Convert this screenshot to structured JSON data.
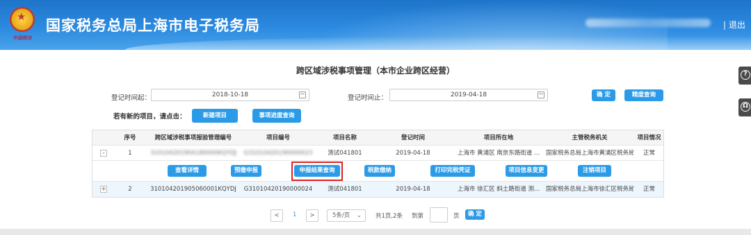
{
  "header": {
    "site_title": "国家税务总局上海市电子税务局",
    "logout": "| 退出",
    "emblem_sig": "中国税务"
  },
  "page": {
    "title": "跨区域涉税事项管理（本市企业跨区经营）"
  },
  "filters": {
    "start_label": "登记时间起：",
    "start_value": "2018-10-18",
    "end_label": "登记时间止：",
    "end_value": "2019-04-18",
    "confirm": "确 定",
    "progress_query": "精度查询",
    "new_item_prompt": "若有新的项目，请点击：",
    "new_item": "新建项目",
    "item_progress": "事项进度查询"
  },
  "table": {
    "headers": [
      "序号",
      "跨区域涉税事项报验管理编号",
      "项目编号",
      "项目名称",
      "登记时间",
      "项目所在地",
      "主管税务机关",
      "项目情况"
    ],
    "rows": [
      {
        "toggle": "-",
        "no": "1",
        "report_no": "310104201904180000KQYDJ",
        "item_no": "G31010420190000023",
        "item_name": "测试041801",
        "reg_time": "2019-04-18",
        "location": "上海市 黄浦区 南京东路街道 ...",
        "tax_office": "国家税务总局上海市黄浦区税务局",
        "status": "正常"
      },
      {
        "toggle": "+",
        "no": "2",
        "report_no": "310104201905060001KQYDJ",
        "item_no": "G31010420190000024",
        "item_name": "测试041801",
        "reg_time": "2019-04-18",
        "location": "上海市 徐汇区 斜土路街道 测...",
        "tax_office": "国家税务总局上海市徐汇区税务局",
        "status": "正常"
      }
    ],
    "ops": [
      "查看详情",
      "预缴申报",
      "申报结果查询",
      "税款缴纳",
      "打印完税凭证",
      "项目信息变更",
      "注销项目"
    ]
  },
  "pagination": {
    "prev": "<",
    "current": "1",
    "next": ">",
    "page_size": "5条/页",
    "summary": "共1页,2条",
    "goto": "到第",
    "page_unit": "页",
    "confirm": "确 定"
  },
  "side": {
    "help": "?",
    "service": "Ω"
  }
}
